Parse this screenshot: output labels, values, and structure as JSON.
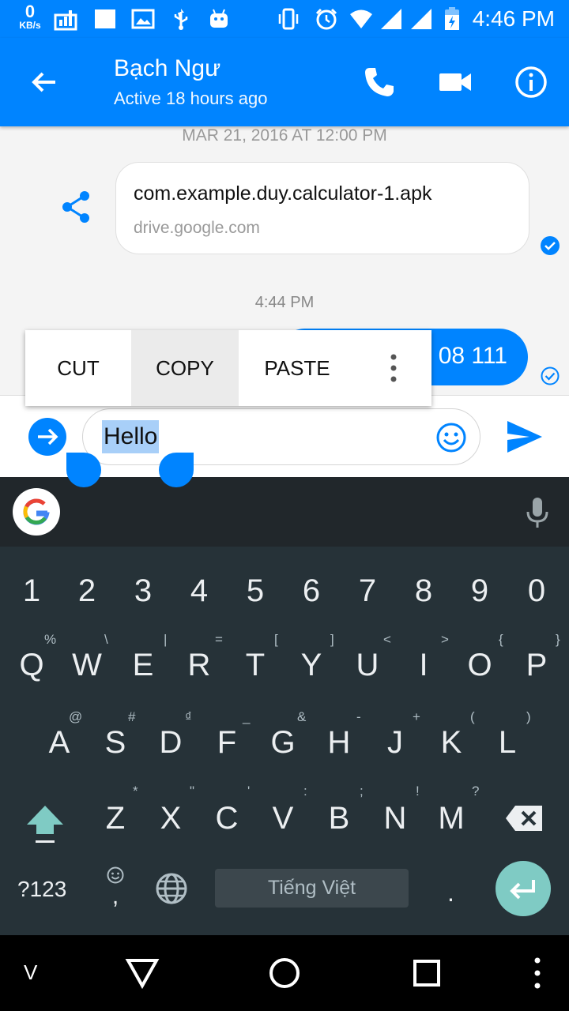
{
  "status_bar": {
    "net_speed_value": "0",
    "net_speed_unit": "KB/s",
    "time": "4:46 PM"
  },
  "header": {
    "contact_name": "Bạch Ngư",
    "active_status": "Active 18 hours ago",
    "icons": [
      "back-arrow-icon",
      "phone-icon",
      "video-camera-icon",
      "info-icon"
    ]
  },
  "chat": {
    "date_separator_1": "MAR 21, 2016 AT 12:00 PM",
    "link_card": {
      "title": "com.example.duy.calculator-1.apk",
      "domain": "drive.google.com"
    },
    "date_separator_2": "4:44 PM",
    "sent_message_visible": "08 111"
  },
  "context_menu": {
    "cut": "CUT",
    "copy": "COPY",
    "paste": "PASTE"
  },
  "composer": {
    "text": "Hello"
  },
  "keyboard": {
    "numbers": [
      "1",
      "2",
      "3",
      "4",
      "5",
      "6",
      "7",
      "8",
      "9",
      "0"
    ],
    "row1": [
      "Q",
      "W",
      "E",
      "R",
      "T",
      "Y",
      "U",
      "I",
      "O",
      "P"
    ],
    "row1_hints": [
      "%",
      "\\",
      "|",
      "=",
      "[",
      "]",
      "<",
      ">",
      "{",
      "}"
    ],
    "row2": [
      "A",
      "S",
      "D",
      "F",
      "G",
      "H",
      "J",
      "K",
      "L"
    ],
    "row2_hints": [
      "@",
      "#",
      "₫",
      "_",
      "&",
      "-",
      "+",
      "(",
      ")"
    ],
    "row3": [
      "Z",
      "X",
      "C",
      "V",
      "B",
      "N",
      "M"
    ],
    "row3_hints": [
      "*",
      "\"",
      "'",
      ":",
      ";",
      "!",
      "?"
    ],
    "symbols_key": "?123",
    "comma": ",",
    "space_label": "Tiếng Việt",
    "period": "."
  },
  "nav_bar": {
    "v_label": "V"
  },
  "colors": {
    "accent": "#0084ff",
    "keyboard_bg": "#263238",
    "enter_key": "#7fcbc4"
  }
}
